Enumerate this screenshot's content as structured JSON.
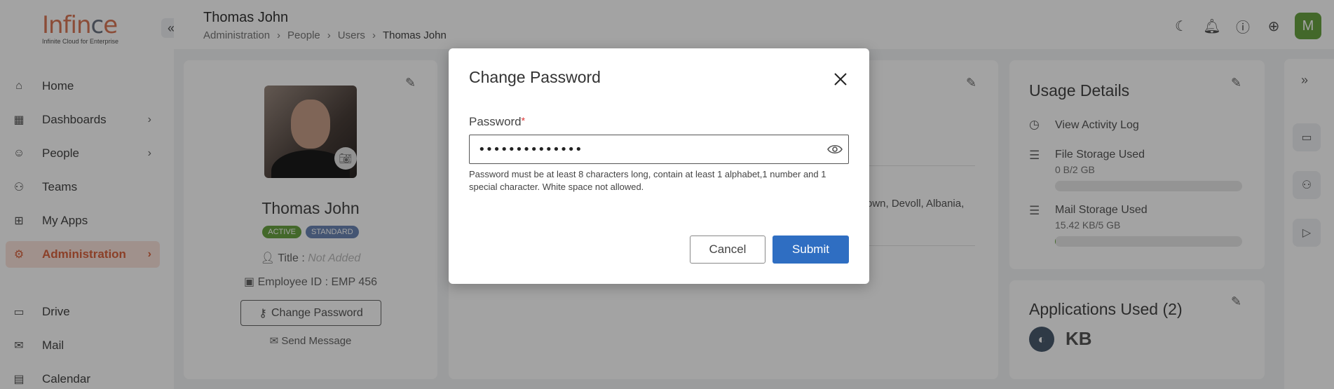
{
  "brand": {
    "logo_text_a": "Infin",
    "logo_text_b": "c",
    "logo_text_c": "e",
    "tagline": "Infinite Cloud for Enterprise"
  },
  "sidebar": {
    "items": [
      {
        "label": "Home",
        "icon": "home-icon"
      },
      {
        "label": "Dashboards",
        "icon": "dashboard-icon"
      },
      {
        "label": "People",
        "icon": "person-icon"
      },
      {
        "label": "Teams",
        "icon": "teams-icon"
      },
      {
        "label": "My Apps",
        "icon": "apps-icon"
      },
      {
        "label": "Administration",
        "icon": "admin-icon",
        "active": true
      },
      {
        "label": "Drive",
        "icon": "drive-icon"
      },
      {
        "label": "Mail",
        "icon": "mail-icon"
      },
      {
        "label": "Calendar",
        "icon": "calendar-icon"
      }
    ]
  },
  "header": {
    "title": "Thomas John",
    "breadcrumb": [
      "Administration",
      "People",
      "Users",
      "Thomas John"
    ],
    "avatar_letter": "M"
  },
  "profile": {
    "name": "Thomas John",
    "badges": [
      "ACTIVE",
      "STANDARD"
    ],
    "title_label": "Title :",
    "title_value": "Not Added",
    "employee_id": "Employee ID : EMP 456",
    "change_password": "Change Password",
    "send_message": "Send Message"
  },
  "middle": {
    "address_partial": "own, Devoll, Albania,"
  },
  "usage": {
    "title": "Usage Details",
    "activity_log": "View Activity Log",
    "file_storage_label": "File Storage Used",
    "file_storage_value": "0 B/2 GB",
    "file_storage_fraction": 0,
    "mail_storage_label": "Mail Storage Used",
    "mail_storage_value": "15.42 KB/5 GB",
    "mail_storage_fraction": 0.003
  },
  "applications": {
    "title": "Applications Used (2)"
  },
  "modal": {
    "title": "Change Password",
    "password_label": "Password",
    "required_mark": "*",
    "password_value": "••••••••••••••",
    "hint": "Password must be at least 8 characters long, contain at least 1 alphabet,1 number and 1 special character. White space not allowed.",
    "cancel": "Cancel",
    "submit": "Submit"
  },
  "colors": {
    "accent": "#d9643f",
    "primary": "#2f6ec2",
    "success": "#6aa343",
    "standard": "#6b86b5"
  }
}
